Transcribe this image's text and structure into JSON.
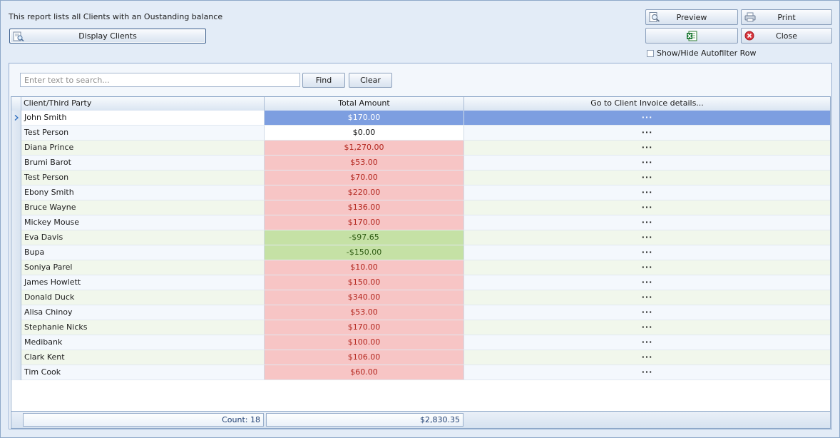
{
  "header": {
    "description": "This report lists all Clients with an Oustanding balance",
    "display_clients_label": "Display Clients",
    "preview_label": "Preview",
    "print_label": "Print",
    "close_label": "Close",
    "autofilter_toggle_label": "Show/Hide Autofilter Row"
  },
  "search": {
    "placeholder": "Enter text to search...",
    "value": "",
    "find_label": "Find",
    "clear_label": "Clear"
  },
  "grid": {
    "columns": [
      "Client/Third Party",
      "Total Amount",
      "Go to Client Invoice details..."
    ],
    "rows": [
      {
        "name": "John Smith",
        "amount": "$170.00",
        "link": "···",
        "status": "selected"
      },
      {
        "name": "Test  Person",
        "amount": "$0.00",
        "link": "···",
        "status": "zero"
      },
      {
        "name": "Diana Prince",
        "amount": "$1,270.00",
        "link": "···",
        "status": "owing"
      },
      {
        "name": "Brumi Barot",
        "amount": "$53.00",
        "link": "···",
        "status": "owing"
      },
      {
        "name": "Test Person",
        "amount": "$70.00",
        "link": "···",
        "status": "owing"
      },
      {
        "name": "Ebony Smith",
        "amount": "$220.00",
        "link": "···",
        "status": "owing"
      },
      {
        "name": "Bruce Wayne",
        "amount": "$136.00",
        "link": "···",
        "status": "owing"
      },
      {
        "name": "Mickey Mouse",
        "amount": "$170.00",
        "link": "···",
        "status": "owing"
      },
      {
        "name": "Eva Davis",
        "amount": "-$97.65",
        "link": "···",
        "status": "credit"
      },
      {
        "name": "Bupa",
        "amount": "-$150.00",
        "link": "···",
        "status": "credit"
      },
      {
        "name": "Soniya Parel",
        "amount": "$10.00",
        "link": "···",
        "status": "owing"
      },
      {
        "name": "James Howlett",
        "amount": "$150.00",
        "link": "···",
        "status": "owing"
      },
      {
        "name": "Donald Duck",
        "amount": "$340.00",
        "link": "···",
        "status": "owing"
      },
      {
        "name": "Alisa Chinoy",
        "amount": "$53.00",
        "link": "···",
        "status": "owing"
      },
      {
        "name": "Stephanie Nicks",
        "amount": "$170.00",
        "link": "···",
        "status": "owing"
      },
      {
        "name": "Medibank",
        "amount": "$100.00",
        "link": "···",
        "status": "owing"
      },
      {
        "name": "Clark Kent",
        "amount": "$106.00",
        "link": "···",
        "status": "owing"
      },
      {
        "name": "Tim Cook",
        "amount": "$60.00",
        "link": "···",
        "status": "owing"
      }
    ],
    "footer": {
      "count": "Count: 18",
      "total": "$2,830.35"
    }
  },
  "icons": {
    "preview": "magnifier-page-icon",
    "print": "printer-icon",
    "excel": "excel-icon",
    "close": "close-circle-icon",
    "display": "report-search-icon"
  },
  "colors": {
    "owing_bg": "#f7c5c5",
    "owing_text": "#b3261e",
    "credit_bg": "#c5e1a5",
    "credit_text": "#2e5b12",
    "selected_bg": "#7d9ee0"
  }
}
